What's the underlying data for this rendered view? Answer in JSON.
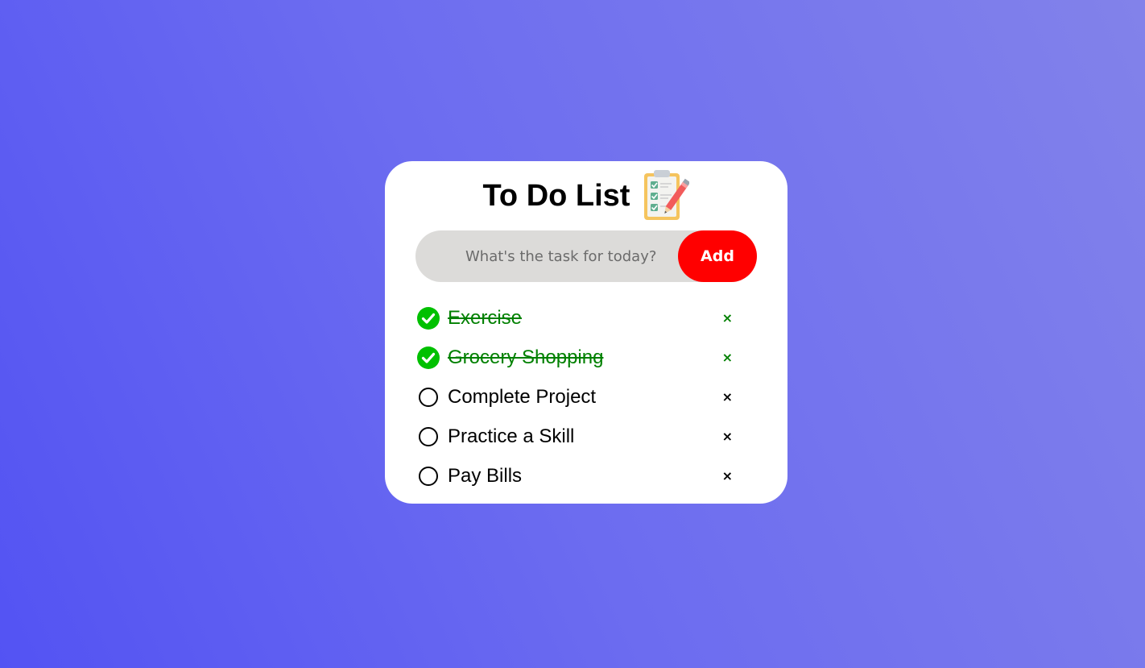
{
  "header": {
    "title": "To Do List",
    "icon": "clipboard-checklist-icon"
  },
  "input": {
    "placeholder": "What's the task for today?",
    "value": "",
    "add_label": "Add"
  },
  "tasks": [
    {
      "label": "Exercise",
      "done": true,
      "delete_label": "×"
    },
    {
      "label": "Grocery Shopping",
      "done": true,
      "delete_label": "×"
    },
    {
      "label": "Complete Project",
      "done": false,
      "delete_label": "×"
    },
    {
      "label": "Practice a Skill",
      "done": false,
      "delete_label": "×"
    },
    {
      "label": "Pay Bills",
      "done": false,
      "delete_label": "×"
    }
  ],
  "colors": {
    "background_start": "#5353f3",
    "background_end": "#8282ea",
    "add_button": "#ff0000",
    "done_text": "#008000",
    "done_check": "#00c000",
    "input_bg": "#dcdbd9"
  }
}
